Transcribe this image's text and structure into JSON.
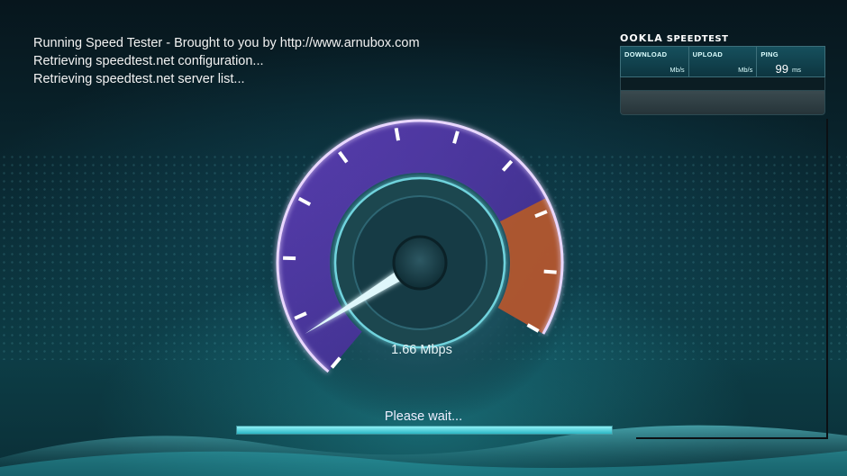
{
  "log": {
    "line1": "Running Speed Tester - Brought to you by http://www.arnubox.com",
    "line2": "Retrieving speedtest.net configuration...",
    "line3": "Retrieving speedtest.net server list..."
  },
  "ookla": {
    "brand": "OOKLA",
    "product": "SPEEDTEST",
    "download": {
      "label": "DOWNLOAD",
      "value": "",
      "unit": "Mb/s"
    },
    "upload": {
      "label": "UPLOAD",
      "value": "",
      "unit": "Mb/s"
    },
    "ping": {
      "label": "PING",
      "value": "99",
      "unit": "ms"
    }
  },
  "gauge": {
    "speed_text": "1.66 Mbps",
    "needle_fraction": 0.07
  },
  "status": {
    "wait_text": "Please wait...",
    "progress": 1.0
  },
  "colors": {
    "arc_purple": "#7a4fd0",
    "arc_orange": "#c7622a",
    "accent_teal": "#2bb6c4"
  }
}
